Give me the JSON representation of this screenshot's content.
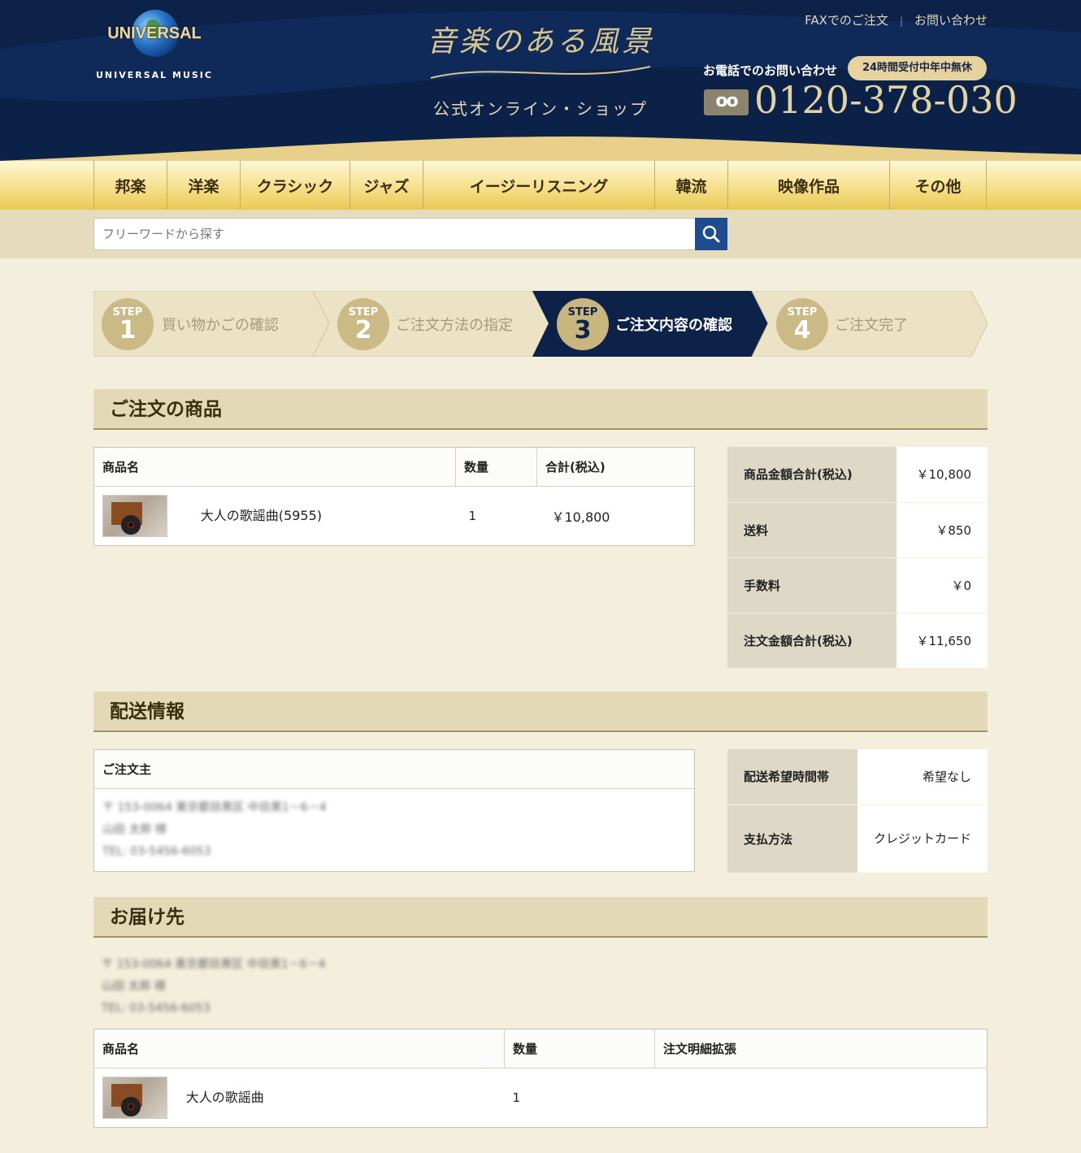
{
  "header": {
    "logo_text": "UNIVERSAL",
    "logo_sub": "UNIVERSAL MUSIC",
    "brand_title": "音楽のある風景",
    "brand_sub": "公式オンライン・ショップ",
    "links": [
      "FAXでのご注文",
      "お問い合わせ"
    ],
    "tel_label": "お電話でのお問い合わせ",
    "tel_badge": "24時間受付中年中無休",
    "tel_icon": "oo",
    "tel_number": "0120-378-030"
  },
  "nav": [
    "邦楽",
    "洋楽",
    "クラシック",
    "ジャズ",
    "イージーリスニング",
    "韓流",
    "映像作品",
    "その他"
  ],
  "search": {
    "placeholder": "フリーワードから探す",
    "icon": "search-icon"
  },
  "steps": [
    {
      "step": "STEP",
      "num": "1",
      "label": "買い物かごの確認"
    },
    {
      "step": "STEP",
      "num": "2",
      "label": "ご注文方法の指定"
    },
    {
      "step": "STEP",
      "num": "3",
      "label": "ご注文内容の確認"
    },
    {
      "step": "STEP",
      "num": "4",
      "label": "ご注文完了"
    }
  ],
  "order_items": {
    "title": "ご注文の商品",
    "headers": [
      "商品名",
      "数量",
      "合計(税込)"
    ],
    "rows": [
      {
        "name": "大人の歌謡曲(5955)",
        "qty": "1",
        "total": "￥10,800"
      }
    ]
  },
  "summary": [
    {
      "label": "商品金額合計(税込)",
      "value": "￥10,800"
    },
    {
      "label": "送料",
      "value": "￥850"
    },
    {
      "label": "手数料",
      "value": "￥0"
    },
    {
      "label": "注文金額合計(税込)",
      "value": "￥11,650"
    }
  ],
  "shipping": {
    "title": "配送情報",
    "orderer_header": "ご注文主",
    "orderer_lines": [
      "〒 153-0064 東京都目黒区 中目黒1－6－4",
      "山田 太郎 様",
      "TEL: 03-5456-6053"
    ],
    "details": [
      {
        "label": "配送希望時間帯",
        "value": "希望なし"
      },
      {
        "label": "支払方法",
        "value": "クレジットカード"
      }
    ]
  },
  "delivery": {
    "title": "お届け先",
    "lines": [
      "〒 153-0064 東京都目黒区 中目黒1－6－4",
      "山田 太郎 様",
      "TEL: 03-5456-6053"
    ],
    "headers": [
      "商品名",
      "数量",
      "注文明細拡張"
    ],
    "rows": [
      {
        "name": "大人の歌謡曲",
        "qty": "1",
        "ext": ""
      }
    ]
  },
  "colors": {
    "navy": "#0d2248",
    "gold": "#e6d39e",
    "search_btn": "#1e4c8f"
  }
}
